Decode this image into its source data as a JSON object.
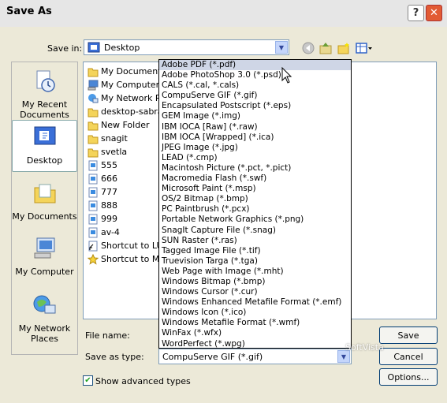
{
  "window": {
    "title": "Save As",
    "help_symbol": "?",
    "close_symbol": "✕"
  },
  "toolbar": {
    "save_in_label": "Save in:",
    "save_in_value": "Desktop",
    "icons": [
      "back-icon",
      "up-folder-icon",
      "new-folder-icon",
      "views-menu-icon"
    ]
  },
  "places": [
    {
      "label": "My Recent Documents",
      "icon": "recent-documents-icon"
    },
    {
      "label": "Desktop",
      "icon": "desktop-icon"
    },
    {
      "label": "My Documents",
      "icon": "my-documents-icon"
    },
    {
      "label": "My Computer",
      "icon": "my-computer-icon"
    },
    {
      "label": "My Network Places",
      "icon": "network-places-icon"
    }
  ],
  "files": [
    {
      "name": "My Documents",
      "icon": "my-documents-icon"
    },
    {
      "name": "My Computer",
      "icon": "my-computer-icon"
    },
    {
      "name": "My Network Plac",
      "icon": "network-places-icon"
    },
    {
      "name": "desktop-sabran",
      "icon": "folder-icon"
    },
    {
      "name": "New Folder",
      "icon": "folder-icon"
    },
    {
      "name": "snagit",
      "icon": "folder-icon"
    },
    {
      "name": "svetla",
      "icon": "folder-icon"
    },
    {
      "name": "555",
      "icon": "image-file-icon"
    },
    {
      "name": "666",
      "icon": "image-file-icon"
    },
    {
      "name": "777",
      "icon": "image-file-icon"
    },
    {
      "name": "888",
      "icon": "image-file-icon"
    },
    {
      "name": "999",
      "icon": "image-file-icon"
    },
    {
      "name": "av-4",
      "icon": "image-file-icon"
    },
    {
      "name": "Shortcut to LUIB",
      "icon": "shortcut-icon"
    },
    {
      "name": "Shortcut to MILE",
      "icon": "shortcut-icon"
    }
  ],
  "file_types": [
    "Adobe PDF (*.pdf)",
    "Adobe PhotoShop 3.0 (*.psd)",
    "CALS (*.cal, *.cals)",
    "CompuServe GIF (*.gif)",
    "Encapsulated Postscript (*.eps)",
    "GEM Image (*.img)",
    "IBM IOCA [Raw] (*.raw)",
    "IBM IOCA [Wrapped] (*.ica)",
    "JPEG Image (*.jpg)",
    "LEAD (*.cmp)",
    "Macintosh Picture (*.pct, *.pict)",
    "Macromedia Flash (*.swf)",
    "Microsoft Paint (*.msp)",
    "OS/2 Bitmap (*.bmp)",
    "PC Paintbrush (*.pcx)",
    "Portable Network Graphics (*.png)",
    "SnagIt Capture File (*.snag)",
    "SUN Raster (*.ras)",
    "Tagged Image File (*.tif)",
    "Truevision Targa (*.tga)",
    "Web Page with Image (*.mht)",
    "Windows Bitmap (*.bmp)",
    "Windows Cursor (*.cur)",
    "Windows Enhanced Metafile Format (*.emf)",
    "Windows Icon (*.ico)",
    "Windows Metafile Format (*.wmf)",
    "WinFax (*.wfx)",
    "WordPerfect (*.wpg)"
  ],
  "highlighted_type_index": 0,
  "form": {
    "file_name_label": "File name:",
    "file_name_value": "",
    "save_as_type_label": "Save as type:",
    "save_as_type_value": "CompuServe GIF (*.gif)",
    "advanced_label": "Show advanced types",
    "advanced_checked": true
  },
  "buttons": {
    "save": "Save",
    "cancel": "Cancel",
    "options": "Options..."
  },
  "watermark": "SoftVista",
  "colors": {
    "highlight": "#cfd6e6",
    "close_button": "#e25b34",
    "input_border": "#7f9db9"
  }
}
